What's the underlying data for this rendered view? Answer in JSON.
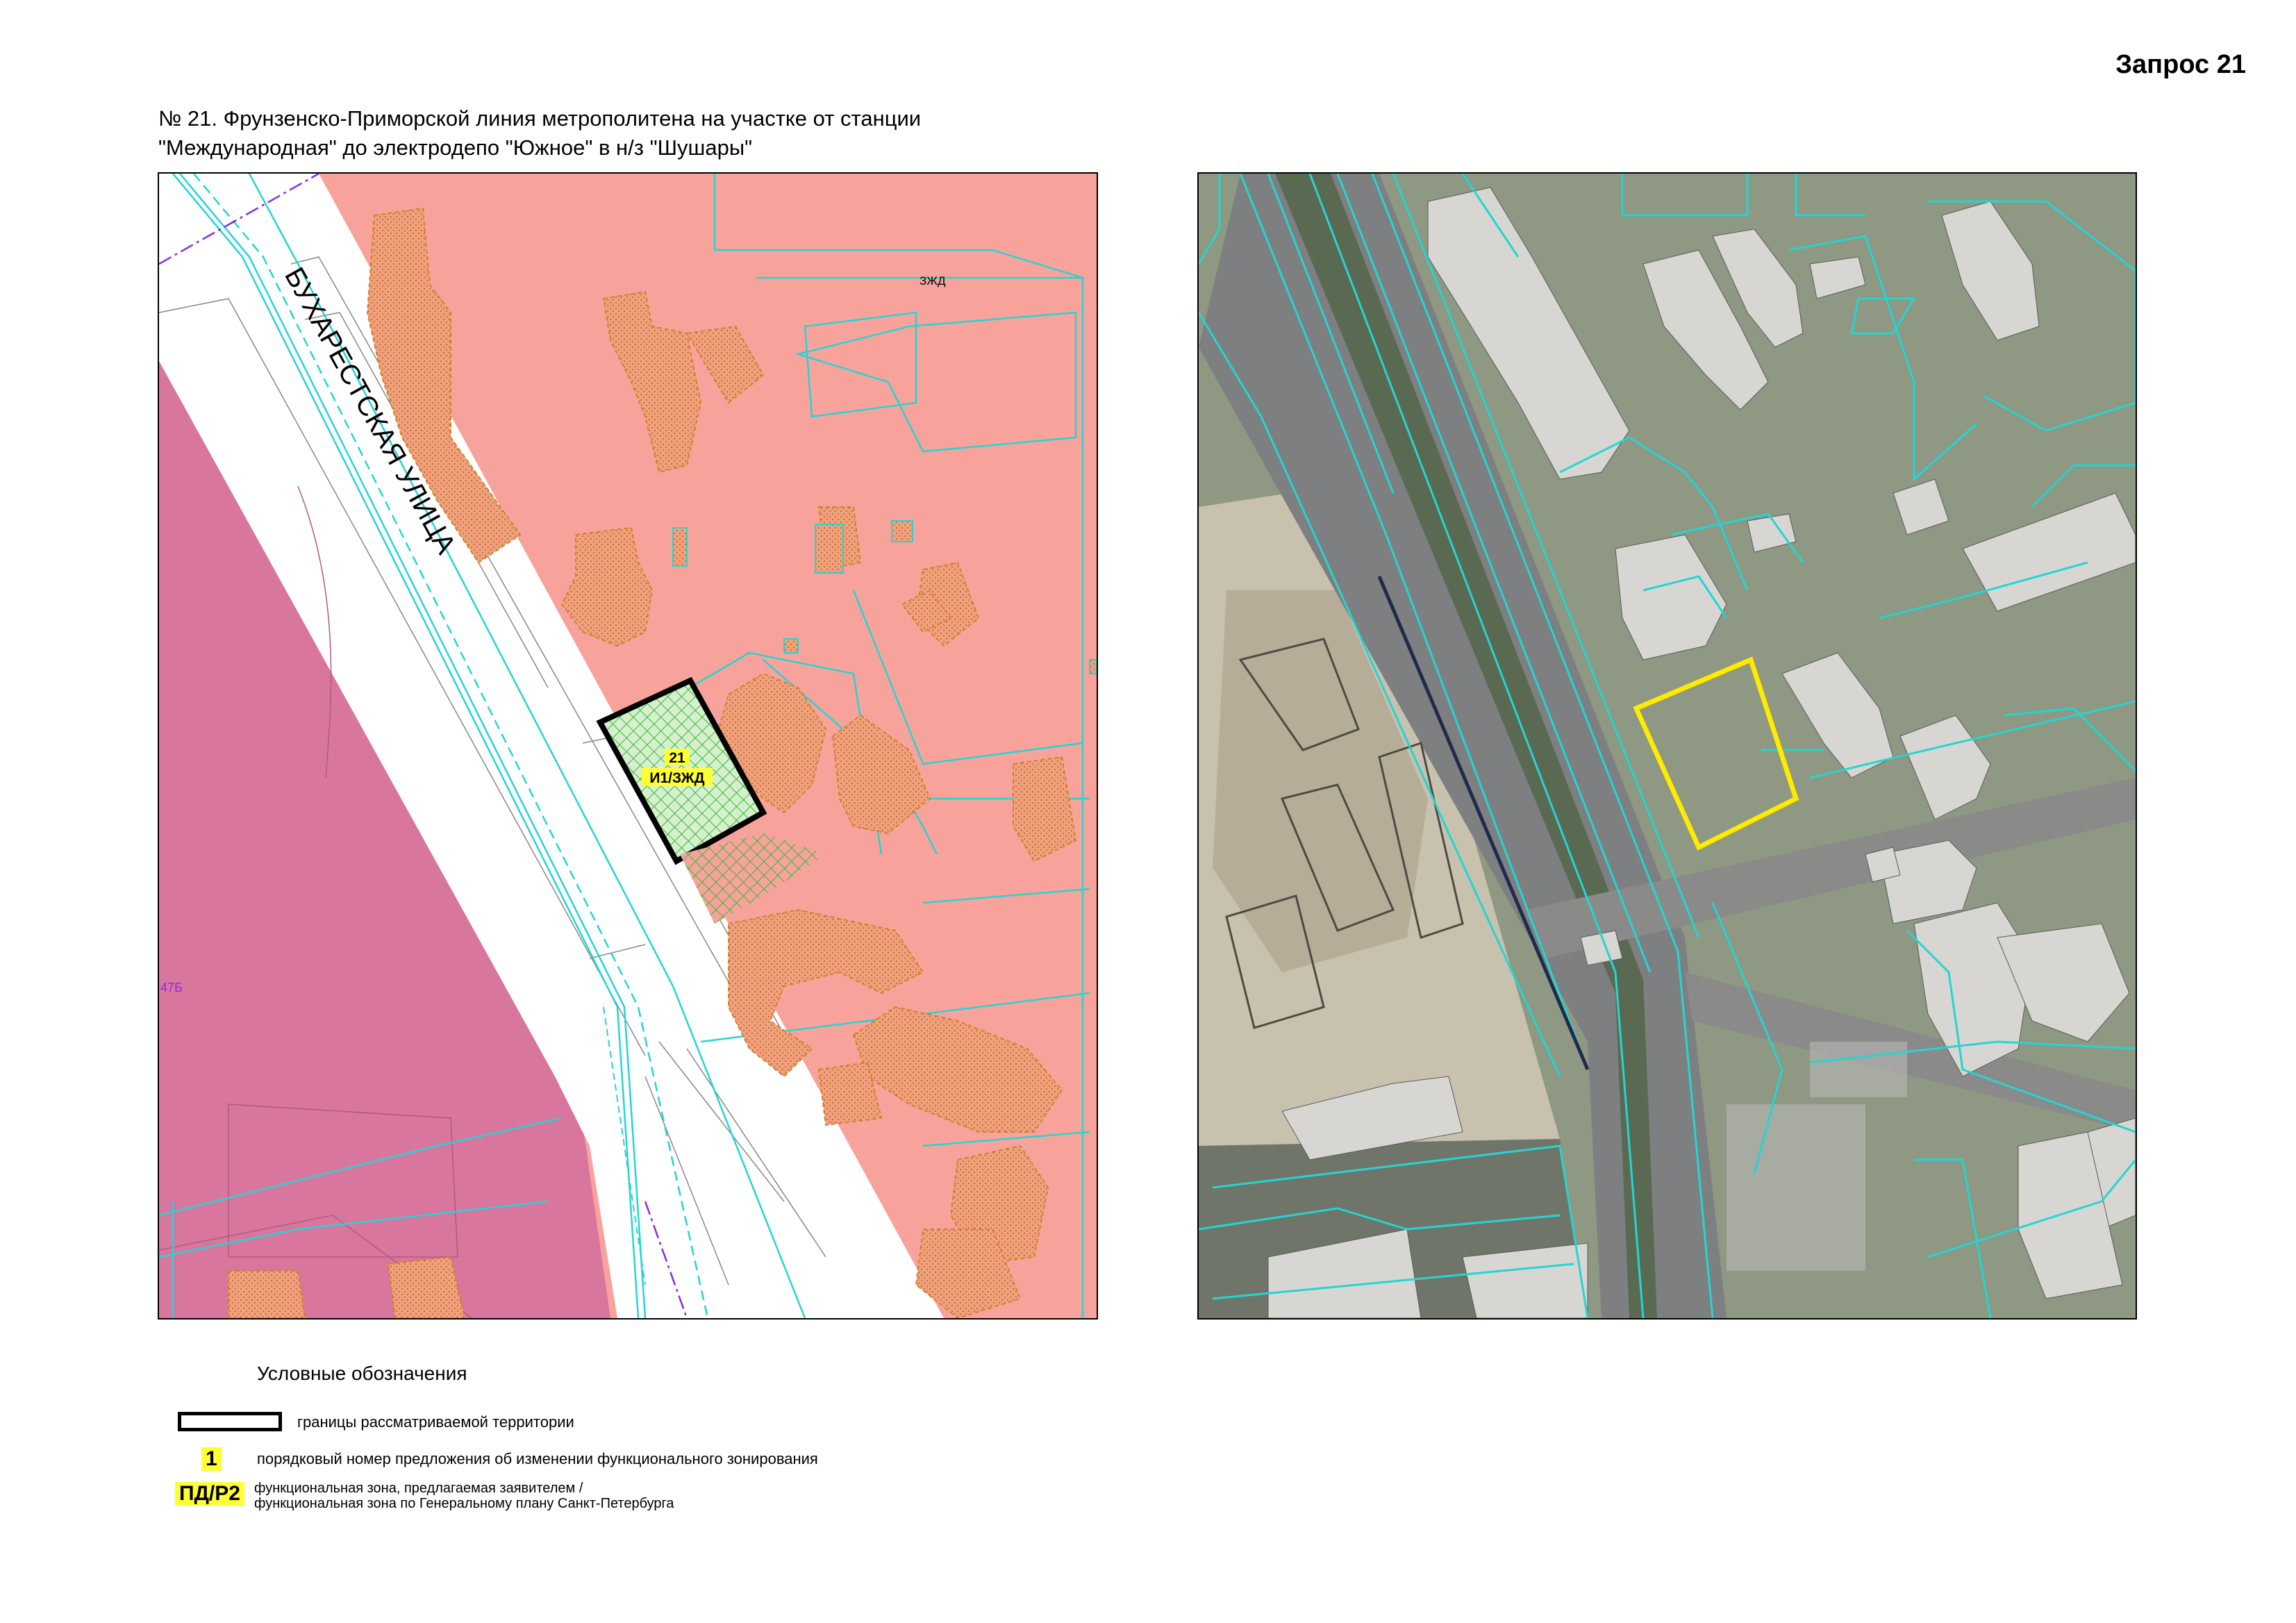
{
  "request_label": "Запрос 21",
  "title": {
    "line1": "№ 21. Фрунзенско-Приморской линия метрополитена на участке от станции",
    "line2": "\"Международная\" до электродепо \"Южное\" в н/з \"Шушары\""
  },
  "zoning_map": {
    "street_label": "БУХАРЕСТСКАЯ УЛИЦА",
    "zone_top": "ЗЖД",
    "zone_left": "47Б",
    "parcel_number": "21",
    "parcel_zone": "И1/ЗЖД"
  },
  "legend": {
    "title": "Условные обозначения",
    "boundary_text": "границы рассматриваемой территории",
    "number_sample": "1",
    "number_text": "порядковый номер предложения об изменении функционального зонирования",
    "zone_sample": "ПД/Р2",
    "zone_text_line1": "функциональная зона, предлагаемая заявителем /",
    "zone_text_line2": "функциональная зона по Генеральному плану Санкт-Петербурга"
  },
  "colors": {
    "residential_zone": "#f7a39c",
    "magenta_zone": "#d8769d",
    "building_hatch": "#f0a17a",
    "cadastral_lines": "#24d5d3",
    "parcel_hatch": "#5fc85a",
    "highlight": "#ffff33",
    "aerial_outline": "#ffeb00"
  }
}
